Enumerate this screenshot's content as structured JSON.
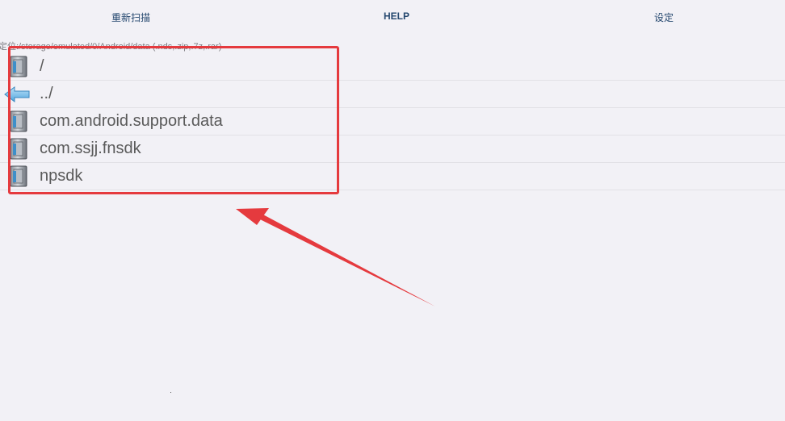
{
  "tabs": {
    "rescan": "重新扫描",
    "help": "HELP",
    "settings": "设定"
  },
  "path_bar": {
    "text": "定位:/storage/emulated/0/Android/data (.nds,.zip,.7z,.rar)"
  },
  "files": [
    {
      "name": "/",
      "icon": "folder-icon"
    },
    {
      "name": "../",
      "icon": "back-arrow-icon"
    },
    {
      "name": "com.android.support.data",
      "icon": "folder-icon"
    },
    {
      "name": "com.ssjj.fnsdk",
      "icon": "folder-icon"
    },
    {
      "name": "npsdk",
      "icon": "folder-icon"
    }
  ],
  "annotation": {
    "highlight_color": "#e53a3e"
  },
  "colors": {
    "background": "#f2f1f6",
    "tab_text": "#24476e",
    "file_text": "#5a5a5a",
    "path_text": "#7d7d82"
  }
}
